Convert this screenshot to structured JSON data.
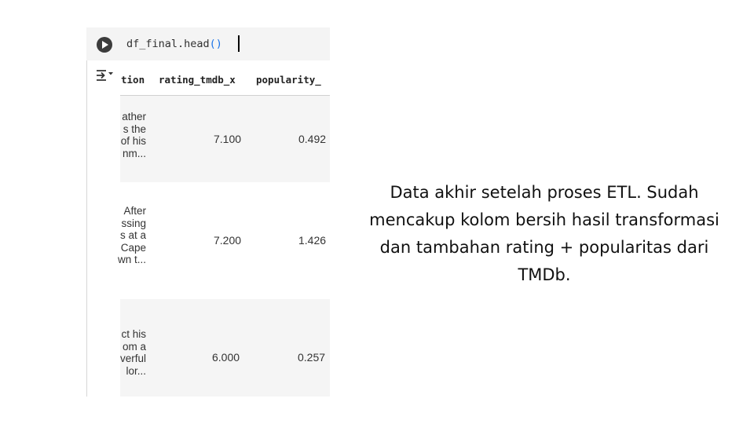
{
  "notebook": {
    "code_cell": {
      "name": "df_final.head",
      "parens": "()"
    },
    "table": {
      "columns": [
        "tion",
        "rating_tmdb_x",
        "popularity_"
      ],
      "rows": [
        {
          "description": [
            "ather",
            "s the",
            "of his",
            "nm..."
          ],
          "rating": "7.100",
          "popularity": "0.492"
        },
        {
          "description": [
            "After",
            "ssing",
            "s at a",
            "Cape",
            "wn t..."
          ],
          "rating": "7.200",
          "popularity": "1.426"
        },
        {
          "description": [
            "ct his",
            "om a",
            "verful",
            "lor..."
          ],
          "rating": "6.000",
          "popularity": "0.257"
        }
      ]
    }
  },
  "caption": "Data akhir setelah proses ETL. Sudah mencakup kolom bersih hasil transformasi dan tambahan rating + popularitas dari TMDb."
}
